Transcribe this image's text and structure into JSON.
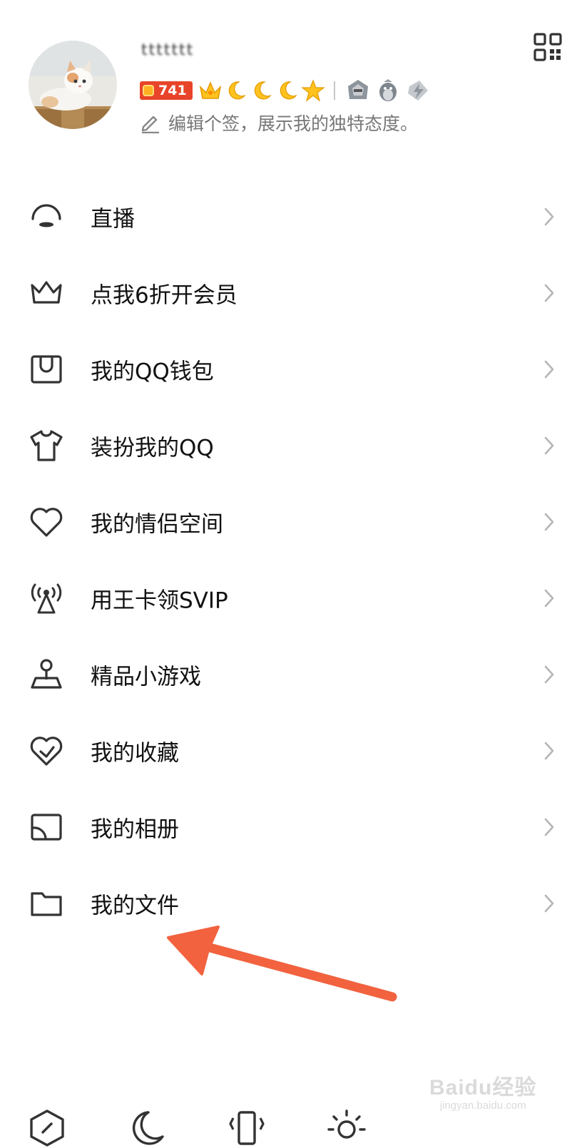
{
  "profile": {
    "name": "𝗍𝗍𝗍𝗍𝗍𝗍𝗍",
    "level": "741",
    "signature": "编辑个签，展示我的独特态度。"
  },
  "menu": [
    {
      "label": "直播",
      "icon": "live-icon"
    },
    {
      "label": "点我6折开会员",
      "icon": "crown-icon"
    },
    {
      "label": "我的QQ钱包",
      "icon": "wallet-icon"
    },
    {
      "label": "装扮我的QQ",
      "icon": "tshirt-icon"
    },
    {
      "label": "我的情侣空间",
      "icon": "heart-icon"
    },
    {
      "label": "用王卡领SVIP",
      "icon": "signal-tower-icon"
    },
    {
      "label": "精品小游戏",
      "icon": "joystick-icon"
    },
    {
      "label": "我的收藏",
      "icon": "favorite-heart-icon"
    },
    {
      "label": "我的相册",
      "icon": "photo-album-icon"
    },
    {
      "label": "我的文件",
      "icon": "folder-icon"
    }
  ],
  "watermark": {
    "main": "Baidu经验",
    "url": "jingyan.baidu.com"
  },
  "colors": {
    "arrow": "#f2623f",
    "level_badge": "#e8442a",
    "icon_stroke": "#333333",
    "chevron": "#b5b5b5"
  }
}
